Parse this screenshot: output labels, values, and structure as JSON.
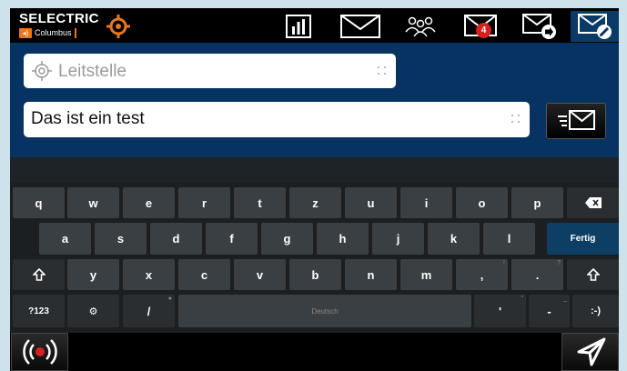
{
  "brand": {
    "name": "SELECTRIC",
    "product": "Columbus",
    "accent": "#e8761f"
  },
  "toolbar": {
    "icons": [
      {
        "name": "bar-chart-icon"
      },
      {
        "name": "message-icon"
      },
      {
        "name": "group-icon"
      },
      {
        "name": "inbox-icon",
        "badge": "4"
      },
      {
        "name": "outbox-icon"
      },
      {
        "name": "compose-icon",
        "active": true
      }
    ]
  },
  "form": {
    "recipient_placeholder": "Leitstelle",
    "message_value": "Das ist ein test"
  },
  "keyboard": {
    "row1": [
      "q",
      "w",
      "e",
      "r",
      "t",
      "z",
      "u",
      "i",
      "o",
      "p"
    ],
    "row2": [
      "a",
      "s",
      "d",
      "f",
      "g",
      "h",
      "j",
      "k",
      "l"
    ],
    "row3": [
      "y",
      "x",
      "c",
      "v",
      "b",
      "n",
      "m",
      ",",
      "."
    ],
    "row3_hints": {
      ",": "!",
      ".": "?"
    },
    "action_label": "Fertig",
    "symbols_label": "?123",
    "slash_label": "/",
    "space_label": "Deutsch",
    "apostrophe_label": "'",
    "dash_label": "-",
    "smiley_label": ":-)",
    "settings_glyph": "⚙"
  },
  "colors": {
    "panel": "#063361",
    "active_tab": "#0a3a66",
    "badge": "#d8201f",
    "fertig": "#0c3f63"
  }
}
